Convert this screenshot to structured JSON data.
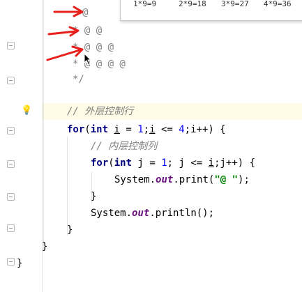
{
  "output_popup": {
    "text": "1*9=9   2*9=18  3*9=27  4*9=36"
  },
  "doc_comment_lines": [
    "@",
    "* @ @",
    "* @ @ @",
    "* @ @ @ @",
    "*/"
  ],
  "code": {
    "comment_outer": "// 外层控制行",
    "outer_for": {
      "kw_for": "for",
      "open": "(",
      "kw_int": "int",
      "var_i": "i",
      "eq": " = ",
      "num_1": "1",
      "semi": ";",
      "cond_i": "i",
      "cond": " <= ",
      "num_4": "4",
      "rest": ";i++) {"
    },
    "comment_inner": "// 内层控制列",
    "inner_for": {
      "kw_for": "for",
      "open": "(",
      "kw_int": "int",
      "decl": " j = ",
      "num_1": "1",
      "cond": "; j <= ",
      "cond_i": "i",
      "rest": ";j++) {"
    },
    "print_stmt": {
      "obj": "System.",
      "field": "out",
      "method": ".print(",
      "str": "\"@ \"",
      "end": ");"
    },
    "close_inner": "}",
    "println_stmt": {
      "obj": "System.",
      "field": "out",
      "method": ".println();"
    },
    "close_outer": "}",
    "close_method": "}",
    "close_class": "}"
  },
  "colors": {
    "keyword": "#000080",
    "number": "#0000ff",
    "string": "#008000",
    "comment": "#808080",
    "field": "#660e7a",
    "annotation_arrow": "#e8201c",
    "line_highlight": "#fdfbe6"
  },
  "icons": {
    "intention_bulb": "lightbulb-icon",
    "fold_marker": "fold-icon",
    "pointer": "mouse-cursor-icon",
    "arrow": "red-arrow-annotation"
  }
}
